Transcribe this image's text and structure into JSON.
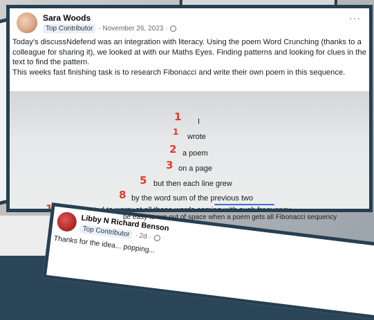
{
  "post": {
    "author": "Sara Woods",
    "badge": "Top Contributor",
    "date": "· November 26, 2023 ·",
    "text_p1": "Today's discussNdefend was an integration with literacy. Using the poem Word Crunching (thanks to a colleague for sharing it), we looked at with our Maths Eyes. Finding patterns and looking for clues in the text to find the pattern.",
    "text_p2": "This weeks fast finishing task is to research Fibonacci and write their own poem in this sequence.",
    "more": "···"
  },
  "poem": {
    "lines": [
      {
        "num": "1",
        "text": "I"
      },
      {
        "num": "1",
        "text": "wrote"
      },
      {
        "num": "2",
        "text": "a poem"
      },
      {
        "num": "3",
        "text": "on a page"
      },
      {
        "num": "5",
        "text": "but then each line grew"
      },
      {
        "num": "8",
        "text": "by the word sum of the previous two"
      },
      {
        "num": "13",
        "text": "until I started to worry at all these words coming with such frequency"
      },
      {
        "num": "",
        "text": "be easy to run out of space when a poem gets all Fibonacci sequency"
      }
    ]
  },
  "comment": {
    "author": "Libby N Richard Benson",
    "badge": "Top Contributor",
    "time": "· 2d ·",
    "text": "Thanks for the idea... popping..."
  },
  "colors": {
    "frame": "#263f52",
    "numbers": "#e33a2c",
    "underline": "#3d6fd1"
  }
}
